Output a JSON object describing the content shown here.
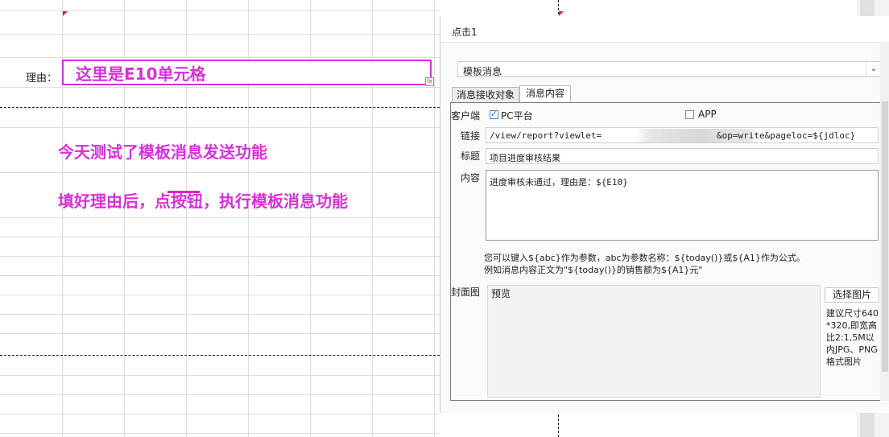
{
  "sheet": {
    "reason_label": "理由：",
    "cell_e10_text": "这里是E10单元格",
    "note_1": "今天测试了模板消息发送功能",
    "note_2": "填好理由后，点按钮，执行模板消息功能"
  },
  "dialog": {
    "title": "点击1",
    "action_type": "模板消息",
    "tabs": [
      {
        "label": "消息接收对象",
        "active": false
      },
      {
        "label": "消息内容",
        "active": true
      }
    ],
    "client_label": "客户端",
    "client_options": [
      {
        "label": "PC平台",
        "checked": true
      },
      {
        "label": "APP",
        "checked": false
      }
    ],
    "link_label": "链接",
    "link_value_start": "/view/report?viewlet=",
    "link_value_end": "&op=write&pageloc=${jdloc}",
    "title_label": "标题",
    "title_value": "项目进度审核结果",
    "content_label": "内容",
    "content_value": "进度审核未通过，理由是：${E10}",
    "hint_line_1": "您可以键入${abc}作为参数，abc为参数名称：${today()}或${A1}作为公式。",
    "hint_line_2": "例如消息内容正文为\"${today()}的销售额为${A1}元\"",
    "cover_label": "封面图",
    "preview_label": "预览",
    "select_image_button": "选择图片",
    "size_hint": "建议尺寸640*320,即宽高比2:1,5M以内JPG、PNG格式图片"
  },
  "colors": {
    "annotation": "#d631d6",
    "checkbox_accent": "#2f74c9"
  }
}
